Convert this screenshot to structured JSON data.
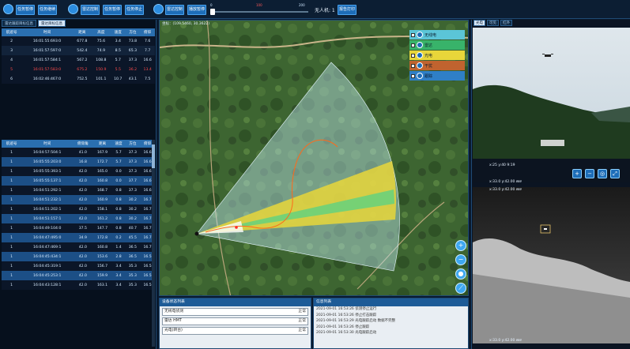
{
  "toolbar": {
    "buttons": [
      "任务暂停",
      "任务继续",
      "雷达控制",
      "任务暂停",
      "任务停止",
      "雷达控制",
      "播放暂停",
      "报告打印"
    ],
    "slider_ticks": [
      "0",
      "100",
      "200"
    ],
    "uav_label": "无人机: 1"
  },
  "left": {
    "tabs": [
      "雷达跟踪目标信息",
      "雷达目标信息"
    ],
    "table1": {
      "headers": [
        "航迹号",
        "时间",
        "距离",
        "高度",
        "速度",
        "方位",
        "俯仰"
      ],
      "rows": [
        [
          "2",
          "16:01:55:693:0",
          "677.8",
          "75.6",
          "3.4",
          "73.8",
          "7.6"
        ],
        [
          "3",
          "16:01:57:597:0",
          "542.4",
          "74.9",
          "8.5",
          "65.3",
          "7.7"
        ],
        [
          "4",
          "16:01:57:584:1",
          "567.2",
          "108.8",
          "5.7",
          "37.3",
          "16.6"
        ],
        [
          "5",
          "16:01:57:583:0",
          "675.2",
          "150.9",
          "5.5",
          "36.2",
          "13.4"
        ],
        [
          "6",
          "16:02:46:467:0",
          "752.5",
          "101.1",
          "10.7",
          "43.1",
          "7.5"
        ]
      ],
      "highlight_row": 3
    },
    "table2": {
      "headers": [
        "航迹号",
        "时间",
        "俯仰角",
        "距离",
        "速度",
        "方位",
        "俯仰"
      ],
      "rows": [
        [
          "1",
          "16:04:57:504:1",
          "41.0",
          "167.9",
          "5.7",
          "37.3",
          "16.6"
        ],
        [
          "1",
          "16:05:55:203:0",
          "16.8",
          "172.7",
          "5.7",
          "37.3",
          "16.6"
        ],
        [
          "1",
          "16:05:55:393:1",
          "42.0",
          "165.0",
          "0.0",
          "37.3",
          "16.6"
        ],
        [
          "1",
          "16:05:55:137:1",
          "42.0",
          "160.8",
          "0.0",
          "37.7",
          "16.6"
        ],
        [
          "1",
          "16:04:51:292:1",
          "42.0",
          "168.7",
          "0.8",
          "37.3",
          "16.6"
        ],
        [
          "1",
          "16:04:51:232:1",
          "42.0",
          "160.9",
          "0.8",
          "30.2",
          "16.7"
        ],
        [
          "1",
          "16:04:51:202:1",
          "42.0",
          "158.1",
          "0.8",
          "30.2",
          "16.7"
        ],
        [
          "1",
          "16:04:51:157:1",
          "42.0",
          "161.2",
          "0.8",
          "30.2",
          "16.7"
        ],
        [
          "1",
          "16:04:49:104:0",
          "37.5",
          "147.7",
          "0.8",
          "40.7",
          "16.7"
        ],
        [
          "1",
          "16:04:47:495:0",
          "34.9",
          "172.8",
          "0.2",
          "45.5",
          "16.7"
        ],
        [
          "1",
          "16:04:47:469:1",
          "42.0",
          "160.8",
          "1.4",
          "36.5",
          "16.7"
        ],
        [
          "1",
          "16:04:45:434:1",
          "42.0",
          "153.6",
          "2.8",
          "36.5",
          "16.5"
        ],
        [
          "1",
          "16:04:45:319:1",
          "42.0",
          "156.7",
          "3.4",
          "35.3",
          "16.5"
        ],
        [
          "1",
          "16:04:45:253:1",
          "42.0",
          "159.9",
          "3.4",
          "35.3",
          "16.5"
        ],
        [
          "1",
          "16:04:43:128:1",
          "42.0",
          "163.1",
          "3.4",
          "35.3",
          "16.5"
        ]
      ]
    }
  },
  "map": {
    "coord": "坐标：(109.5460, 30.3622)",
    "legend": [
      {
        "label": "无线电",
        "color": "#5bc5d7"
      },
      {
        "label": "雷达",
        "color": "#38b36a"
      },
      {
        "label": "光电",
        "color": "#e8d63a"
      },
      {
        "label": "干扰",
        "color": "#c0632f"
      },
      {
        "label": "跟踪",
        "color": "#2f7fc6"
      }
    ],
    "tools": [
      "zoom-in-icon",
      "zoom-out-icon",
      "locate-icon",
      "measure-icon"
    ]
  },
  "bottom": {
    "device_title": "设备状态列表",
    "devices": [
      {
        "name": "无线电侦测",
        "status": "正常"
      },
      {
        "name": "雷达 HMT",
        "status": "正常"
      },
      {
        "name": "光电(转台)",
        "status": "正常"
      }
    ],
    "message_title": "信息列表",
    "messages": [
      "2021-09-01 16:53:26 侦测停止运行",
      "2021-09-01 16:53:26 停止打击跟踪",
      "2021-09-01 16:53:29 光电跟踪启动 数据不完整",
      "2021-09-01 16:53:26 停止跟踪",
      "2021-09-01 16:53:30 光电跟踪启动"
    ]
  },
  "right": {
    "tabs": [
      "光电",
      "可见",
      "红外"
    ],
    "visible_timestamps": [
      "x:25 y:40  9:19",
      "x:33.0 y:42.00  ∂∂∂"
    ],
    "ir_timestamps": [
      "x:33.0 y:42.00  ∂∂∂",
      "x:33.0 y:42.00  ∂∂∂"
    ]
  }
}
